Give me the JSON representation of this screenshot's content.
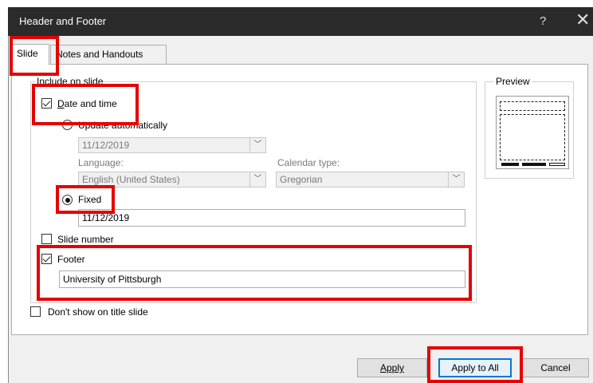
{
  "window": {
    "title": "Header and Footer",
    "help_glyph": "?",
    "close_glyph": "✕"
  },
  "tabs": [
    {
      "label": "Slide",
      "active": true
    },
    {
      "label": "Notes and Handouts",
      "active": false
    }
  ],
  "include_group": {
    "label": "Include on slide"
  },
  "date_and_time": {
    "label": "Date and time",
    "checked": true,
    "update_auto": {
      "label": "Update automatically",
      "selected": false,
      "date_value": "11/12/2019"
    },
    "language": {
      "label": "Language:",
      "value": "English (United States)"
    },
    "calendar": {
      "label": "Calendar type:",
      "value": "Gregorian"
    },
    "fixed": {
      "label": "Fixed",
      "selected": true,
      "value": "11/12/2019"
    }
  },
  "slide_number": {
    "label": "Slide number",
    "checked": false
  },
  "footer": {
    "label": "Footer",
    "checked": true,
    "value": "University of Pittsburgh"
  },
  "dont_show_title": {
    "label": "Don't show on title slide",
    "checked": false
  },
  "preview": {
    "label": "Preview"
  },
  "buttons": {
    "apply": "Apply",
    "apply_all": "Apply to All",
    "cancel": "Cancel"
  },
  "colors": {
    "highlight": "#e60000",
    "titlebar": "#2b2b2b",
    "default_button_border": "#0078d7"
  }
}
